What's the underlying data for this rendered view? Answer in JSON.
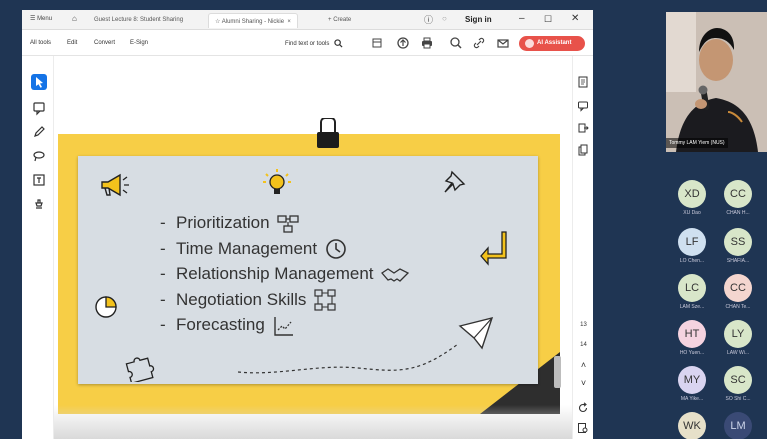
{
  "titlebar": {
    "menu": "Menu",
    "tabs": [
      "Guest Lecture 8: Student Sharing",
      "Alumni Sharing - Nickie",
      "Create"
    ],
    "sign_in": "Sign in"
  },
  "toolbar": {
    "items": [
      "All tools",
      "Edit",
      "Convert",
      "E-Sign"
    ],
    "find": "Find text or tools",
    "ai_button": "AI Assistant"
  },
  "slide": {
    "bullets": [
      {
        "dash": "-",
        "text": "Prioritization"
      },
      {
        "dash": "-",
        "text": "Time Management"
      },
      {
        "dash": "-",
        "text": "Relationship Management"
      },
      {
        "dash": "-",
        "text": "Negotiation Skills"
      },
      {
        "dash": "-",
        "text": "Forecasting"
      }
    ]
  },
  "right_rail": {
    "page_current": "13",
    "page_total": "14"
  },
  "call": {
    "speaker_name": "Tommy LAM Yiem (NUS)",
    "participants": [
      {
        "initials": "XD",
        "name": "XU Dao",
        "color": "#d8e6c9"
      },
      {
        "initials": "CC",
        "name": "CHAN H...",
        "color": "#d8e6c9"
      },
      {
        "initials": "LF",
        "name": "LO Chen...",
        "color": "#cfe0f0"
      },
      {
        "initials": "SS",
        "name": "SHAFIA...",
        "color": "#d8e6c9"
      },
      {
        "initials": "LC",
        "name": "LAM Sze...",
        "color": "#d8e6c9"
      },
      {
        "initials": "CC",
        "name": "CHAN Te...",
        "color": "#f4d6cf"
      },
      {
        "initials": "HT",
        "name": "HO Yuen...",
        "color": "#f5d3e0"
      },
      {
        "initials": "LY",
        "name": "LAW Wi...",
        "color": "#d8e6c9"
      },
      {
        "initials": "MY",
        "name": "MA Yike...",
        "color": "#d9d4f0"
      },
      {
        "initials": "SC",
        "name": "SO Shi C...",
        "color": "#d8e6c9"
      },
      {
        "initials": "WK",
        "name": "",
        "color": "#e6e0c9"
      },
      {
        "initials": "LM",
        "name": "",
        "color": "#3a4a75"
      }
    ]
  }
}
